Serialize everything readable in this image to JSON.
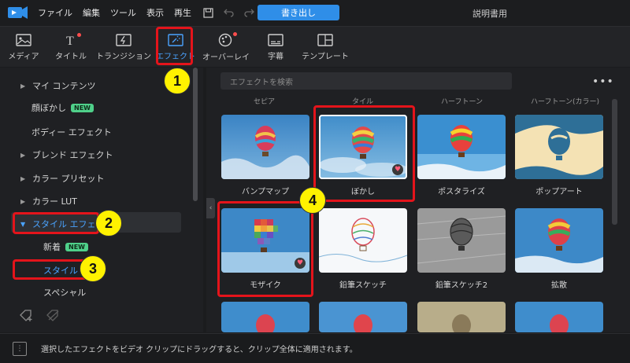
{
  "menu": [
    "ファイル",
    "編集",
    "ツール",
    "表示",
    "再生"
  ],
  "export_label": "書き出し",
  "manual_label": "説明書用",
  "tools": [
    {
      "label": "メディア",
      "icon": "media-icon"
    },
    {
      "label": "タイトル",
      "icon": "title-icon"
    },
    {
      "label": "トランジション",
      "icon": "transition-icon"
    },
    {
      "label": "エフェクト",
      "icon": "effect-icon"
    },
    {
      "label": "オーバーレイ",
      "icon": "overlay-icon"
    },
    {
      "label": "字幕",
      "icon": "subtitle-icon"
    },
    {
      "label": "テンプレート",
      "icon": "template-icon"
    }
  ],
  "sidebar": {
    "items": [
      {
        "label": "マイ コンテンツ"
      },
      {
        "label": "顔ぼかし",
        "badge": "NEW"
      },
      {
        "label": "ボディー エフェクト"
      },
      {
        "label": "ブレンド エフェクト"
      },
      {
        "label": "カラー プリセット"
      },
      {
        "label": "カラー LUT"
      },
      {
        "label": "スタイル エフェクト"
      },
      {
        "label": "新着",
        "badge": "NEW"
      },
      {
        "label": "スタイル"
      },
      {
        "label": "スペシャル"
      }
    ]
  },
  "search_placeholder": "エフェクトを検索",
  "more_label": "•••",
  "cut_labels": [
    "セピア",
    "タイル",
    "ハーフトーン",
    "ハーフトーン(カラー)"
  ],
  "effects_row1": [
    "バンプマップ",
    "ぼかし",
    "ポスタライズ",
    "ポップアート"
  ],
  "effects_row2": [
    "モザイク",
    "鉛筆スケッチ",
    "鉛筆スケッチ2",
    "拡散"
  ],
  "callouts": [
    "1",
    "2",
    "3",
    "4"
  ],
  "status_text": "選択したエフェクトをビデオ クリップにドラッグすると、クリップ全体に適用されます。",
  "colors": {
    "accent": "#2f8ee8",
    "annotation_red": "#e4141b",
    "callout_yellow": "#fff200",
    "new_badge": "#4fd08a"
  }
}
